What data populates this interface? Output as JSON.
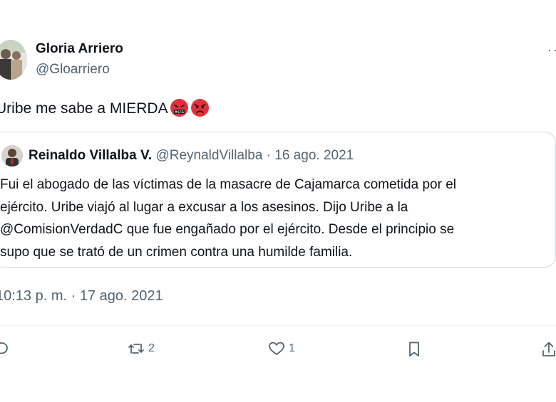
{
  "tweet": {
    "author_name": "Gloria Arriero",
    "author_handle": "@Gloarriero",
    "more_icon": "more-dots-icon",
    "text": "Uribe me sabe a MIERDA",
    "emojis": [
      "swearing-face-emoji",
      "angry-face-emoji"
    ],
    "timestamp": "10:13 p. m. · 17 ago. 2021"
  },
  "quote": {
    "name": "Reinaldo Villalba V.",
    "handle": "@ReynaldVillalba",
    "separator": "·",
    "date": "16 ago. 2021",
    "lines": [
      "Fui el abogado de las víctimas de la masacre de Cajamarca cometida por el",
      "ejército. Uribe viajó al lugar a excusar a los asesinos.  Dijo Uribe a la",
      "@ComisionVerdadC que fue engañado por el ejército. Desde el principio se",
      "supo que se trató de un crimen contra una humilde familia."
    ]
  },
  "actions": {
    "reply_icon": "reply-icon",
    "retweet_icon": "retweet-icon",
    "retweet_count": "2",
    "like_icon": "heart-icon",
    "like_count": "1",
    "bookmark_icon": "bookmark-icon",
    "share_icon": "share-icon"
  },
  "colors": {
    "text": "#0f1419",
    "secondary": "#536471",
    "border": "#cfd9de",
    "emoji_red": "#e0323c"
  }
}
